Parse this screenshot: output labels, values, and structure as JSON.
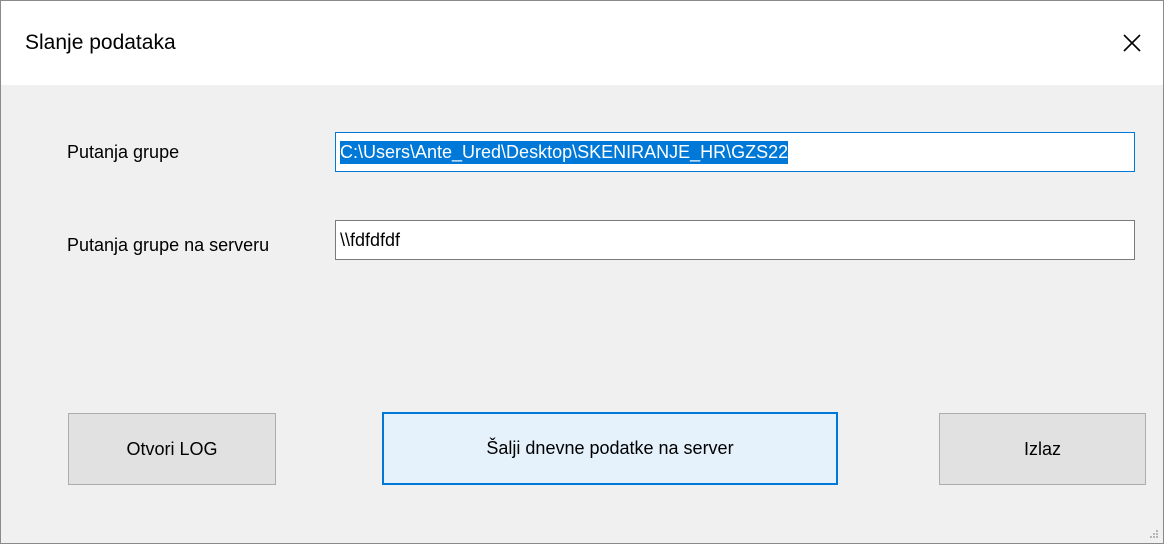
{
  "window": {
    "title": "Slanje podataka",
    "close_icon": "close-icon"
  },
  "form": {
    "group_path_label": "Putanja grupe",
    "group_path_value": "C:\\Users\\Ante_Ured\\Desktop\\SKENIRANJE_HR\\GZS22",
    "server_path_label": "Putanja grupe na serveru",
    "server_path_value": "\\\\fdfdfdf"
  },
  "buttons": {
    "open_log": "Otvori LOG",
    "send_daily": "Šalji dnevne podatke na server",
    "exit": "Izlaz"
  },
  "colors": {
    "accent": "#0078d7",
    "button_face": "#e1e1e1",
    "default_button_face": "#e5f1fb",
    "client_background": "#f0f0f0"
  }
}
